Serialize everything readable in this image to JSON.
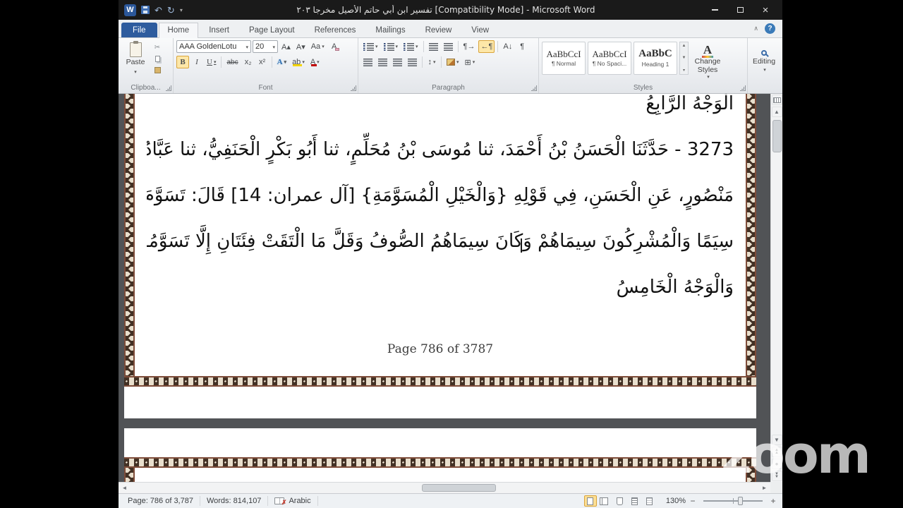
{
  "titlebar": {
    "title": "تفسير ابن أبي حاتم الأصيل مخرجا ٢٠٣ [Compatibility Mode] - Microsoft Word"
  },
  "icons": {
    "w_logo": "W",
    "undo": "↶",
    "repeat": "↻",
    "caret": "▾",
    "close": "×",
    "collapse": "∧",
    "help": "?",
    "scissors": "✂",
    "grow_font": "A▴",
    "shrink_font": "A▾",
    "change_case": "Aa",
    "clear_format": "A",
    "bold": "B",
    "italic": "I",
    "underline": "U",
    "strike": "abc",
    "subscript": "x₂",
    "superscript": "x²",
    "effects": "A",
    "highlight": "ab",
    "font_color": "A",
    "ltr": "¶→",
    "rtl": "←¶",
    "sort": "A↓",
    "pilcrow": "¶",
    "line_spacing": "↕",
    "borders": "⊞",
    "up": "▲",
    "down": "▼",
    "left": "◄",
    "right": "►",
    "ball": "●",
    "spell_x": "✗",
    "minus": "−",
    "plus": "+"
  },
  "ribbon": {
    "tabs": [
      {
        "label": "File"
      },
      {
        "label": "Home"
      },
      {
        "label": "Insert"
      },
      {
        "label": "Page Layout"
      },
      {
        "label": "References"
      },
      {
        "label": "Mailings"
      },
      {
        "label": "Review"
      },
      {
        "label": "View"
      }
    ],
    "clipboard": {
      "group_label": "Clipboa...",
      "paste": "Paste"
    },
    "font": {
      "group_label": "Font",
      "name": "AAA GoldenLotu",
      "size": "20"
    },
    "paragraph": {
      "group_label": "Paragraph"
    },
    "styles": {
      "group_label": "Styles",
      "items": [
        {
          "preview": "AaBbCcI",
          "name": "¶ Normal"
        },
        {
          "preview": "AaBbCcI",
          "name": "¶ No Spaci..."
        },
        {
          "preview": "AaBbC",
          "name": "Heading 1"
        }
      ],
      "change_line1": "Change",
      "change_line2": "Styles"
    },
    "editing": {
      "label": "Editing"
    }
  },
  "document": {
    "partial_top_line": "الْوَجْهُ الرَّابِعُ",
    "lines": [
      "3273 - حَدَّثَنَا الْحَسَنُ بْنُ أَحْمَدَ، ثنا مُوسَى بْنُ مُحَلِّمٍ، ثنا أَبُو بَكْرٍ الْحَنَفِيُّ، ثنا عَبَّادُ بْنُ",
      "مَنْصُورٍ، عَنِ الْحَسَنِ، فِي قَوْلِهِ {وَالْخَيْلِ الْمُسَوَّمَةِ} [آل عمران: 14] قَالَ: تَسَوَّمَ الْمُسْلِمُونَ",
      "سِيَمًا وَالْمُشْرِكُونَ سِيمَاهُمْ وَكَانَ سِيمَاهُمُ الصُّوفُ وَقَلَّ مَا الْتَقَتْ فِئَتَانِ إِلَّا تَسَوَّمُوا أَحْيَاهُمْ",
      "وَالْوَجْهُ الْخَامِسُ"
    ],
    "footer": "Page 786 of 3787"
  },
  "statusbar": {
    "page": "Page: 786 of 3,787",
    "words": "Words: 814,107",
    "language": "Arabic",
    "zoom_level": "130%"
  },
  "watermark": "zoom",
  "colors": {
    "accent_blue": "#2b579a",
    "highlight_orange": "#fde7a8",
    "border_brown": "#7e4c39",
    "page_white": "#ffffff",
    "desk_gray": "#515356"
  }
}
